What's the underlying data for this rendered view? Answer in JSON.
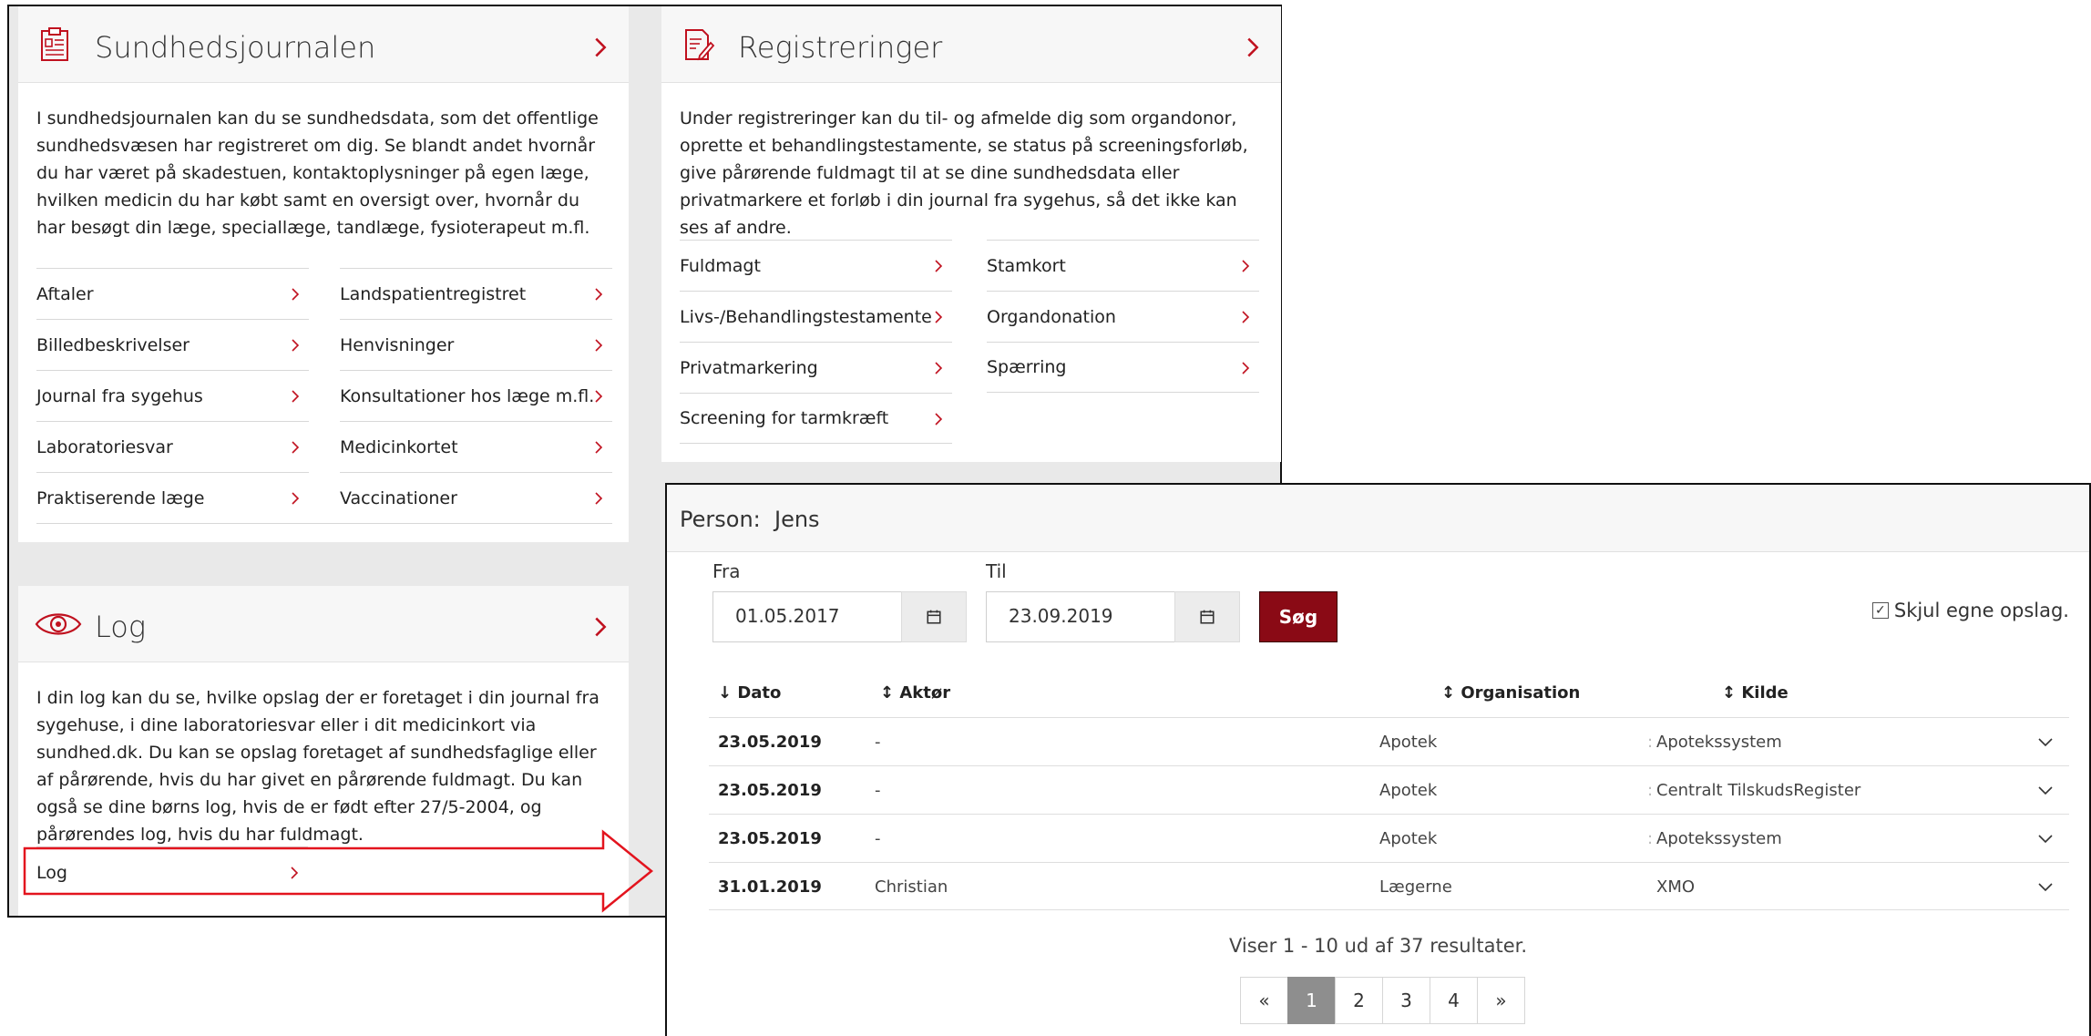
{
  "sundhedsjournalen": {
    "title": "Sundhedsjournalen",
    "description": "I sundhedsjournalen kan du se sundhedsdata, som det offentlige sundhedsvæsen har registreret om dig. Se blandt andet hvornår du har været på skadestuen, kontaktoplysninger på egen læge, hvilken medicin du har købt samt en oversigt over, hvornår du har besøgt din læge, speciallæge, tandlæge, fysioterapeut m.fl.",
    "links": [
      "Aftaler",
      "Landspatientregistret",
      "Billedbeskrivelser",
      "Henvisninger",
      "Journal fra sygehus",
      "Konsultationer hos læge m.fl.",
      "Laboratoriesvar",
      "Medicinkortet",
      "Praktiserende læge",
      "Vaccinationer"
    ]
  },
  "registreringer": {
    "title": "Registreringer",
    "description": "Under registreringer kan du til- og afmelde dig som organdonor, oprette et behandlingstestamente, se status på screeningsforløb, give pårørende fuldmagt til at se dine sundhedsdata eller privatmarkere et forløb i din journal fra sygehus, så det ikke kan ses af andre.",
    "links": [
      "Fuldmagt",
      "Stamkort",
      "Livs-/Behandlingstestamente",
      "Organdonation",
      "Privatmarkering",
      "Spærring",
      "Screening for tarmkræft"
    ]
  },
  "log": {
    "title": "Log",
    "description": "I din log kan du se, hvilke opslag der er foretaget i din journal fra sygehuse, i dine laboratoriesvar eller i dit medicinkort via sundhed.dk. Du kan se opslag foretaget af sundhedsfaglige eller af pårørende, hvis du har givet en pårørende fuldmagt. Du kan også se dine børns log, hvis de er født efter 27/5-2004, og pårørendes log, hvis du har fuldmagt.",
    "link": "Log"
  },
  "logview": {
    "person_label": "Person:",
    "person_name": "Jens",
    "from_label": "Fra",
    "from_value": "01.05.2017",
    "to_label": "Til",
    "to_value": "23.09.2019",
    "search_label": "Søg",
    "hide_own_label": "Skjul egne opslag.",
    "headers": {
      "dato": "↓ Dato",
      "aktor": "↕ Aktør",
      "organisation": "↕ Organisation",
      "kilde": "↕ Kilde"
    },
    "rows": [
      {
        "dato": "23.05.2019",
        "aktor": "-",
        "organisation": "Apotek",
        "sep": ":",
        "kilde": "Apotekssystem"
      },
      {
        "dato": "23.05.2019",
        "aktor": "-",
        "organisation": "Apotek",
        "sep": ":",
        "kilde": "Centralt TilskudsRegister"
      },
      {
        "dato": "23.05.2019",
        "aktor": "-",
        "organisation": "Apotek",
        "sep": ":",
        "kilde": "Apotekssystem"
      },
      {
        "dato": "31.01.2019",
        "aktor": "Christian",
        "organisation": "Lægerne",
        "sep": "",
        "kilde": "XMO"
      }
    ],
    "results_text": "Viser 1 - 10 ud af 37 resultater.",
    "pager": [
      "«",
      "1",
      "2",
      "3",
      "4",
      "»"
    ],
    "active_page": "1"
  },
  "colors": {
    "accent": "#c0111f",
    "button": "#8a0a15",
    "callout": "#e3141e"
  },
  "icons": {
    "journal": "clipboard-icon",
    "registreringer": "document-pen-icon",
    "log": "eye-icon",
    "chevron": "chevron-right-icon",
    "calendar": "calendar-icon",
    "expand": "chevron-down-icon"
  }
}
